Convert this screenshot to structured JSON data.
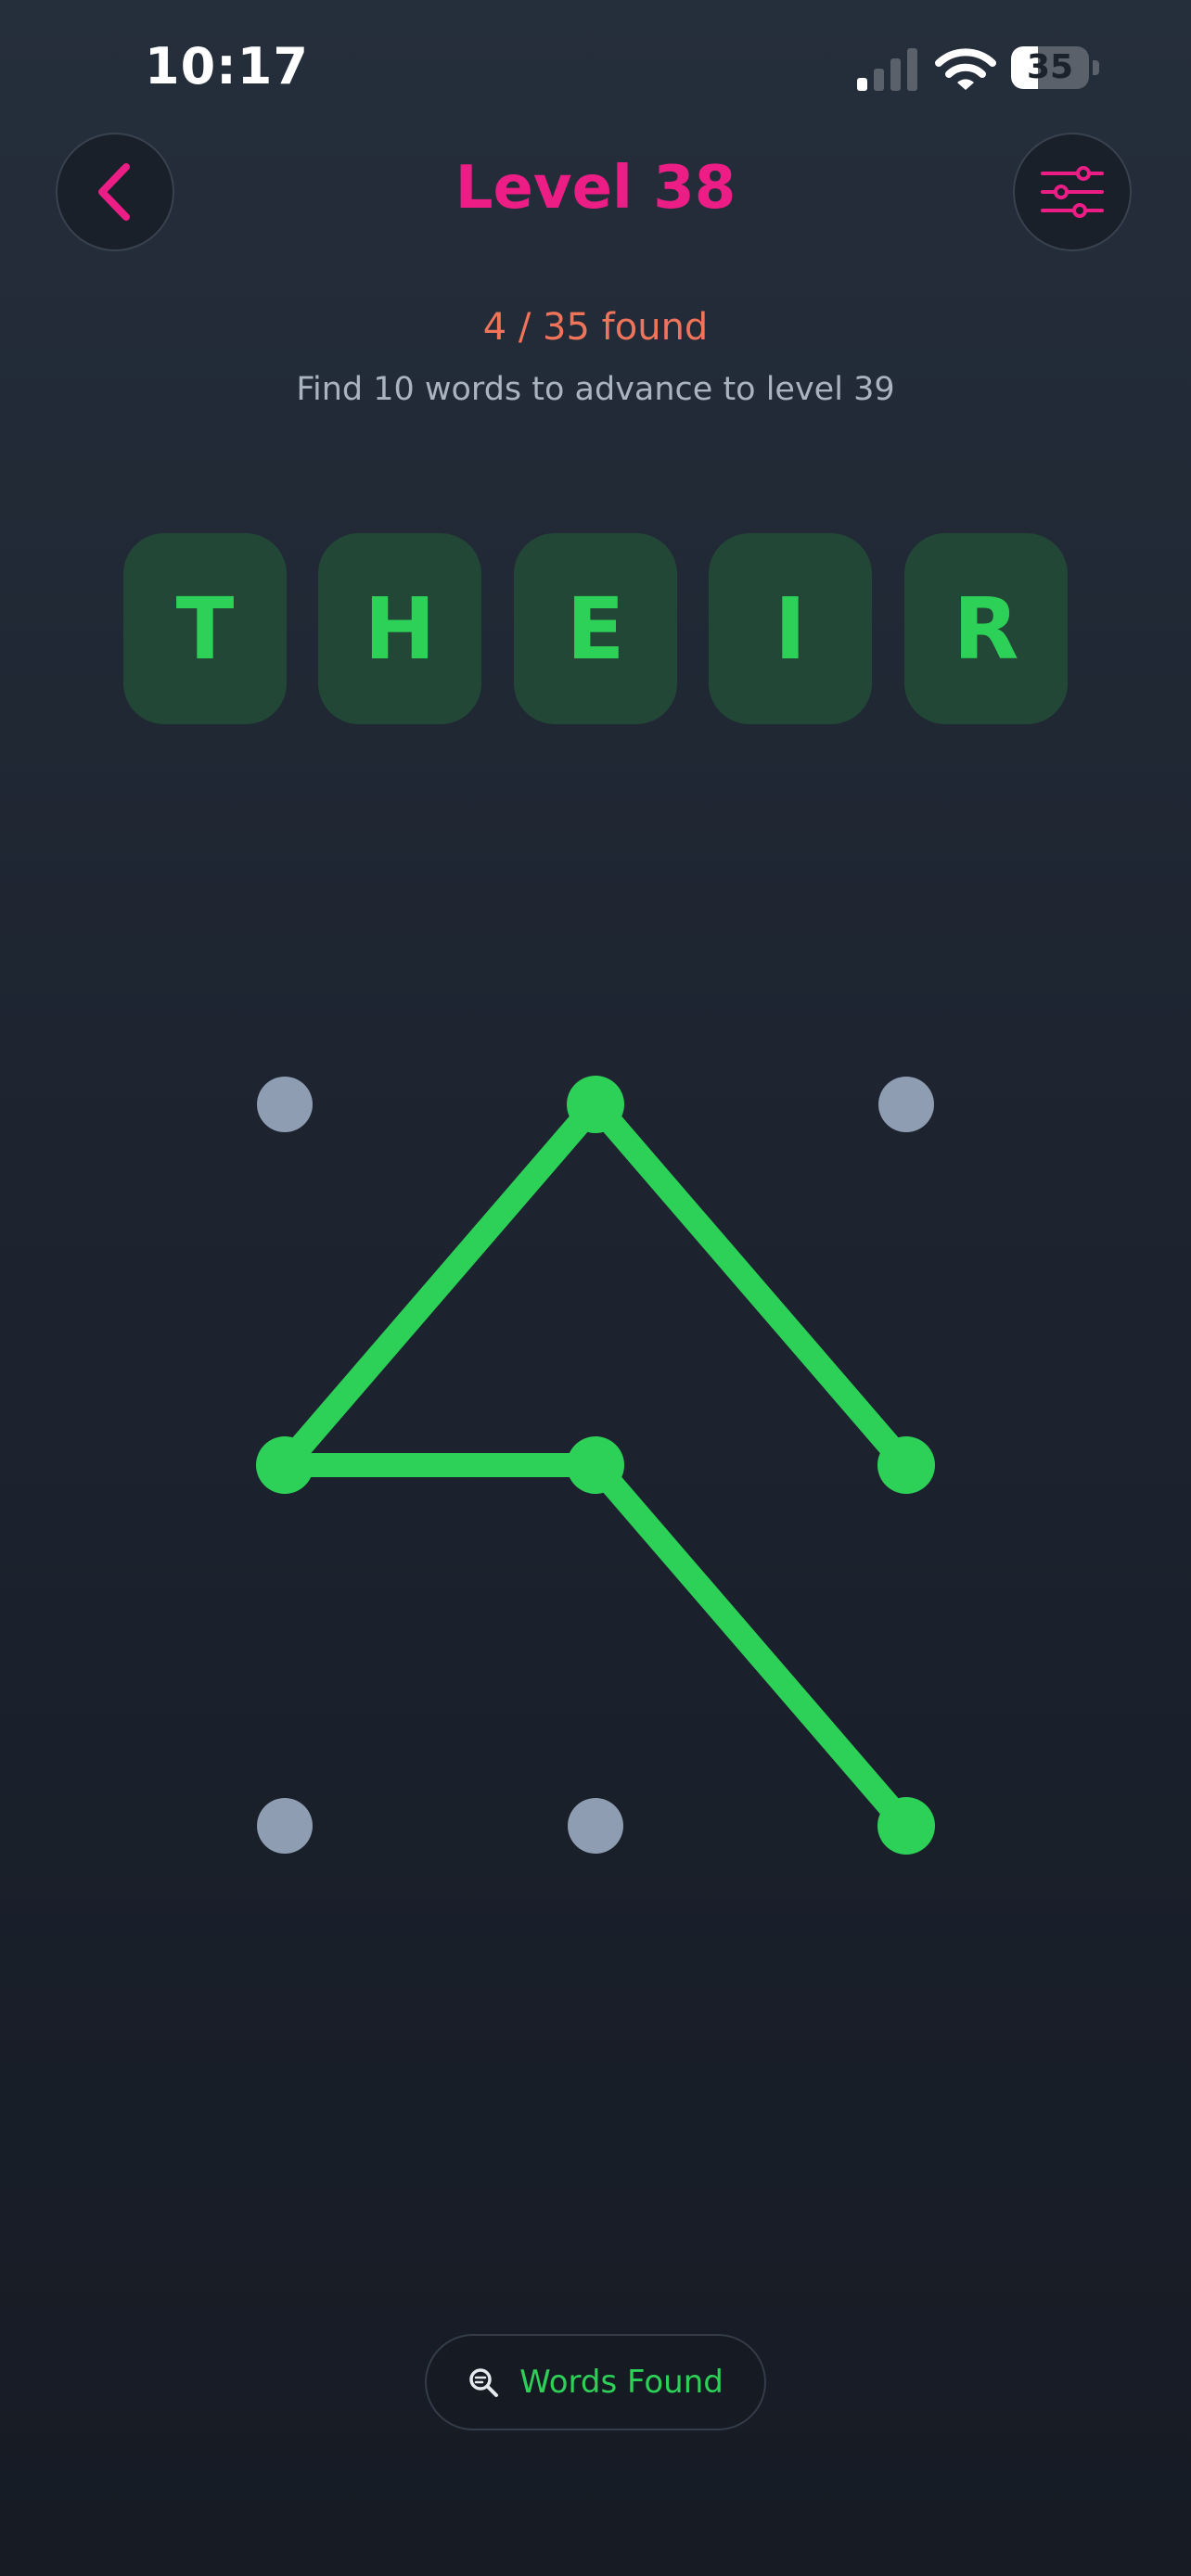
{
  "status_bar": {
    "time": "10:17",
    "battery_percent": "35",
    "battery_level": 0.35,
    "signal_bars_active": 1,
    "signal_bars_total": 4
  },
  "header": {
    "back_icon": "chevron-left-icon",
    "title": "Level 38",
    "settings_icon": "sliders-icon"
  },
  "progress": {
    "found_text": "4 / 35 found",
    "advance_text": "Find 10 words to advance to level 39"
  },
  "current_word": {
    "letters": [
      "T",
      "H",
      "E",
      "I",
      "R"
    ]
  },
  "pattern_grid": {
    "rows": 3,
    "cols": 3,
    "selected_path": [
      [
        0,
        1
      ],
      [
        1,
        0
      ],
      [
        1,
        1
      ],
      [
        2,
        2
      ]
    ],
    "extra_segments": [
      [
        [
          0,
          1
        ],
        [
          1,
          2
        ]
      ]
    ]
  },
  "footer": {
    "words_found_label": "Words Found",
    "words_found_icon": "search-icon"
  },
  "colors": {
    "accent_pink": "#ec1e86",
    "count_orange": "#f0745a",
    "active_green": "#2ed158",
    "tile_bg": "#234736",
    "inactive_dot": "#8e9db2"
  }
}
